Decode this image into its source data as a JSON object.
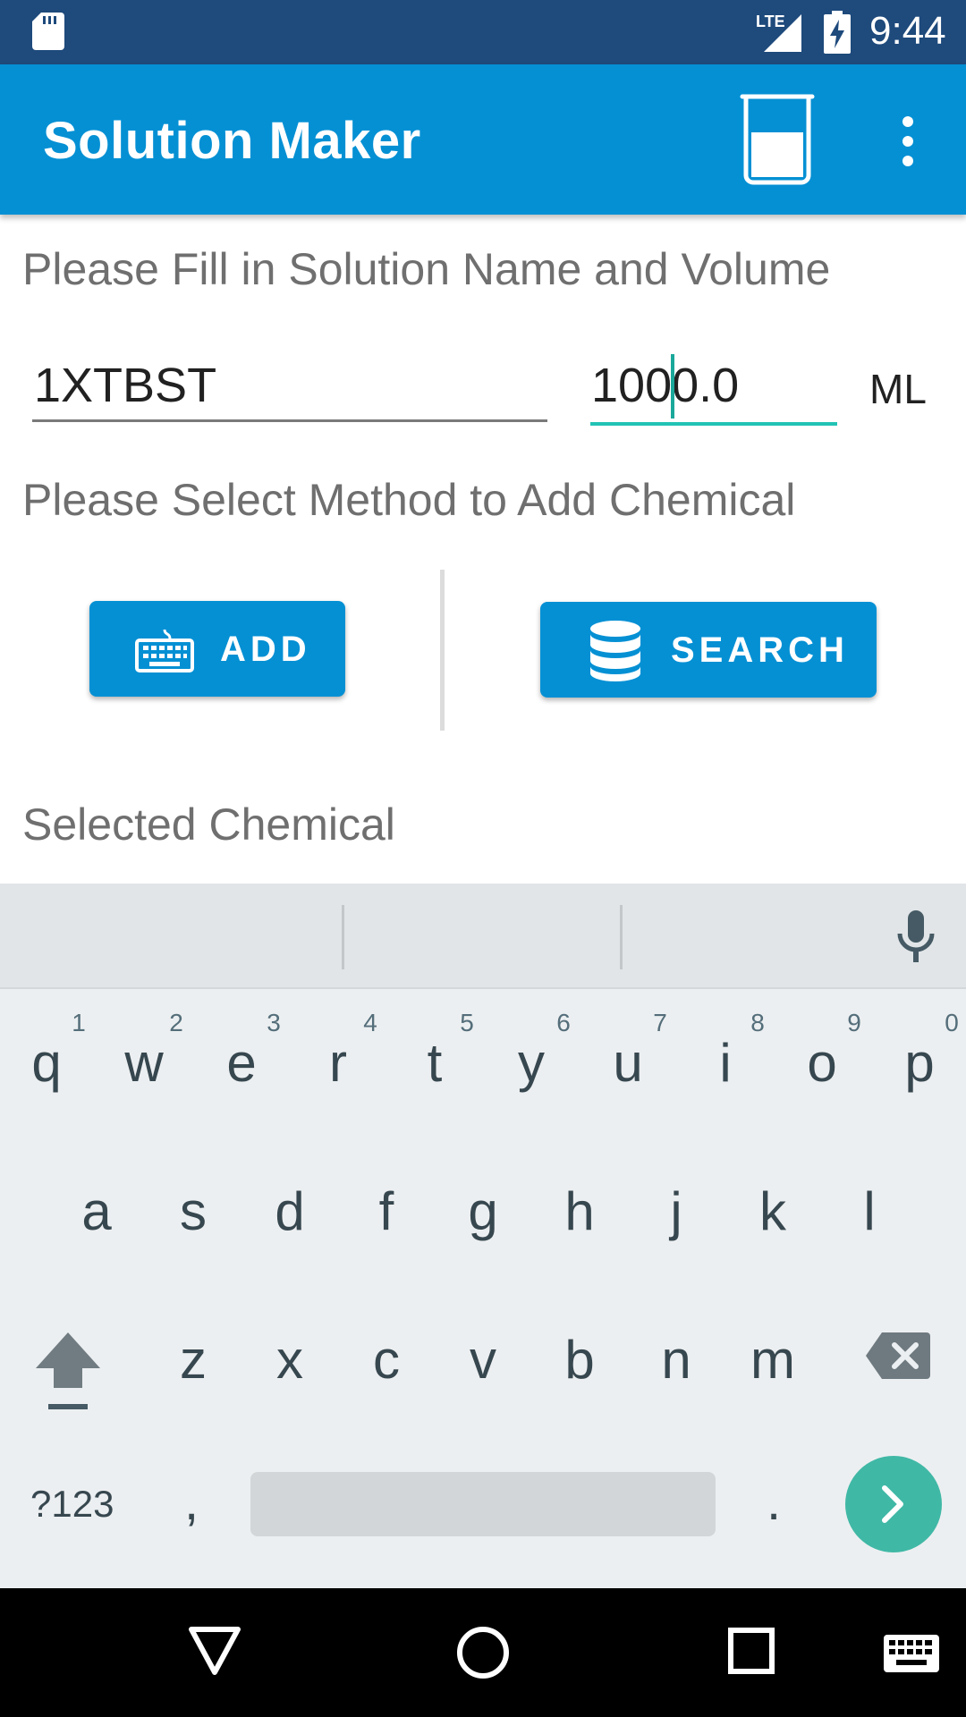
{
  "status_bar": {
    "time": "9:44",
    "network": "LTE",
    "icons": [
      "sd-card-icon",
      "lte-signal-icon",
      "battery-charging-icon"
    ]
  },
  "app_bar": {
    "title": "Solution Maker",
    "icons": [
      "beaker-icon",
      "overflow-menu-icon"
    ],
    "color": "#0590d4"
  },
  "form": {
    "prompt_name_volume": "Please Fill in Solution Name and Volume",
    "solution_name": "1XTBST",
    "volume": "1000.0",
    "unit": "ML",
    "prompt_method": "Please Select Method to Add Chemical",
    "add_button": "ADD",
    "search_button": "SEARCH",
    "selected_heading": "Selected Chemical"
  },
  "keyboard": {
    "row1": [
      {
        "key": "q",
        "hint": "1"
      },
      {
        "key": "w",
        "hint": "2"
      },
      {
        "key": "e",
        "hint": "3"
      },
      {
        "key": "r",
        "hint": "4"
      },
      {
        "key": "t",
        "hint": "5"
      },
      {
        "key": "y",
        "hint": "6"
      },
      {
        "key": "u",
        "hint": "7"
      },
      {
        "key": "i",
        "hint": "8"
      },
      {
        "key": "o",
        "hint": "9"
      },
      {
        "key": "p",
        "hint": "0"
      }
    ],
    "row2": [
      "a",
      "s",
      "d",
      "f",
      "g",
      "h",
      "j",
      "k",
      "l"
    ],
    "row3": [
      "z",
      "x",
      "c",
      "v",
      "b",
      "n",
      "m"
    ],
    "symbols_key": "?123",
    "comma_key": ",",
    "period_key": ".",
    "accent": "#40b8a6"
  },
  "nav_bar": {
    "icons": [
      "back-icon",
      "home-icon",
      "recents-icon",
      "keyboard-switch-icon"
    ]
  }
}
